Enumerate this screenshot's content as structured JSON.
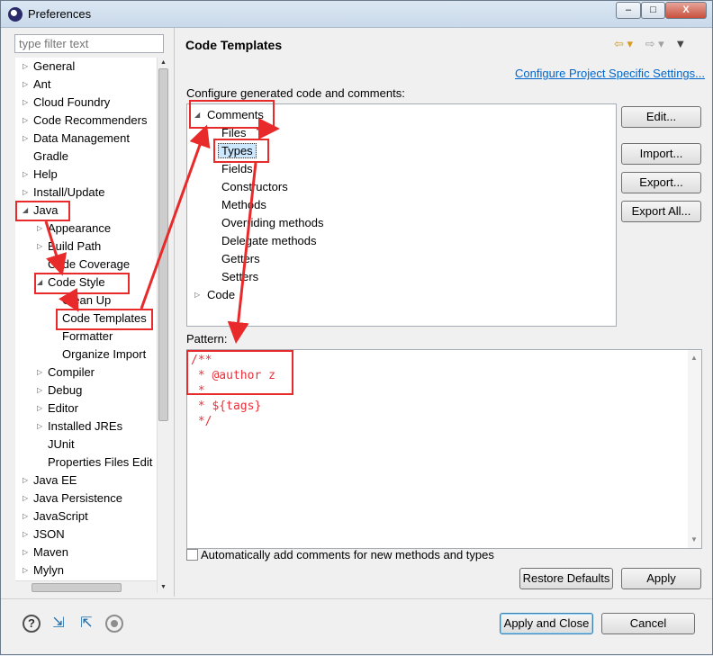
{
  "window": {
    "title": "Preferences",
    "min": "‒",
    "max": "□",
    "close": "X"
  },
  "filter": {
    "placeholder": "type filter text"
  },
  "tree": [
    "General",
    "Ant",
    "Cloud Foundry",
    "Code Recommenders",
    "Data Management",
    "Gradle",
    "Help",
    "Install/Update",
    "Java",
    "Appearance",
    "Build Path",
    "Code Coverage",
    "Code Style",
    "Clean Up",
    "Code Templates",
    "Formatter",
    "Organize Import",
    "Compiler",
    "Debug",
    "Editor",
    "Installed JREs",
    "JUnit",
    "Properties Files Edit",
    "Java EE",
    "Java Persistence",
    "JavaScript",
    "JSON",
    "Maven",
    "Mylyn"
  ],
  "page": {
    "title": "Code Templates",
    "configure_link": "Configure Project Specific Settings...",
    "configure_label": "Configure generated code and comments:",
    "pattern_label": "Pattern:",
    "pattern": "/**\n * @author z\n *\n * ${tags}\n */",
    "auto_comments_label": "Automatically add comments for new methods and types"
  },
  "templates_tree": [
    "Comments",
    "Files",
    "Types",
    "Fields",
    "Constructors",
    "Methods",
    "Overriding methods",
    "Delegate methods",
    "Getters",
    "Setters",
    "Code"
  ],
  "buttons": {
    "edit": "Edit...",
    "import": "Import...",
    "export": "Export...",
    "export_all": "Export All...",
    "restore_defaults": "Restore Defaults",
    "apply": "Apply",
    "apply_close": "Apply and Close",
    "cancel": "Cancel"
  },
  "icons": {
    "help": "?",
    "import": "⇲",
    "export": "⇱",
    "nav_back": "⇦ ▾",
    "nav_fwd": "⇨ ▾",
    "menu": "▼"
  },
  "colors": {
    "annotation": "#e82a2a",
    "link": "#0066cc",
    "pattern_text": "#e8313a"
  }
}
